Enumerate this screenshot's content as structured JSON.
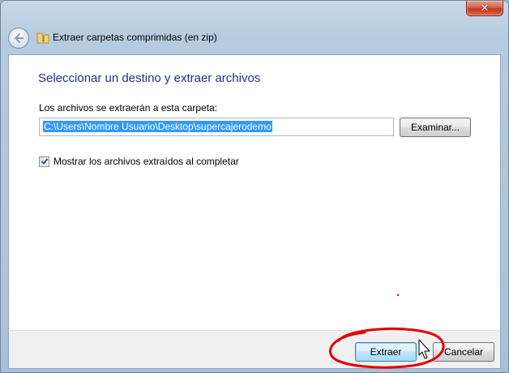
{
  "window": {
    "title": "Extraer carpetas comprimidas (en zip)",
    "close_label": "✕"
  },
  "dialog": {
    "heading": "Seleccionar un destino y extraer archivos",
    "destination_label": "Los archivos se extraerán a esta carpeta:",
    "destination_path": "C:\\Users\\Nombre Usuario\\Desktop\\supercajerodemo",
    "browse_label": "Examinar...",
    "show_files_label": "Mostrar los archivos extraídos al completar",
    "show_files_checked": true
  },
  "footer": {
    "extract_label": "Extraer",
    "cancel_label": "Cancelar"
  },
  "icons": {
    "back": "back-arrow-icon",
    "title": "zip-folder-icon",
    "checkbox": "check-mark-icon",
    "cursor": "hand-pointer-icon"
  },
  "colors": {
    "heading": "#1e3287",
    "selection": "#3399ff",
    "annotation": "#e00000"
  }
}
